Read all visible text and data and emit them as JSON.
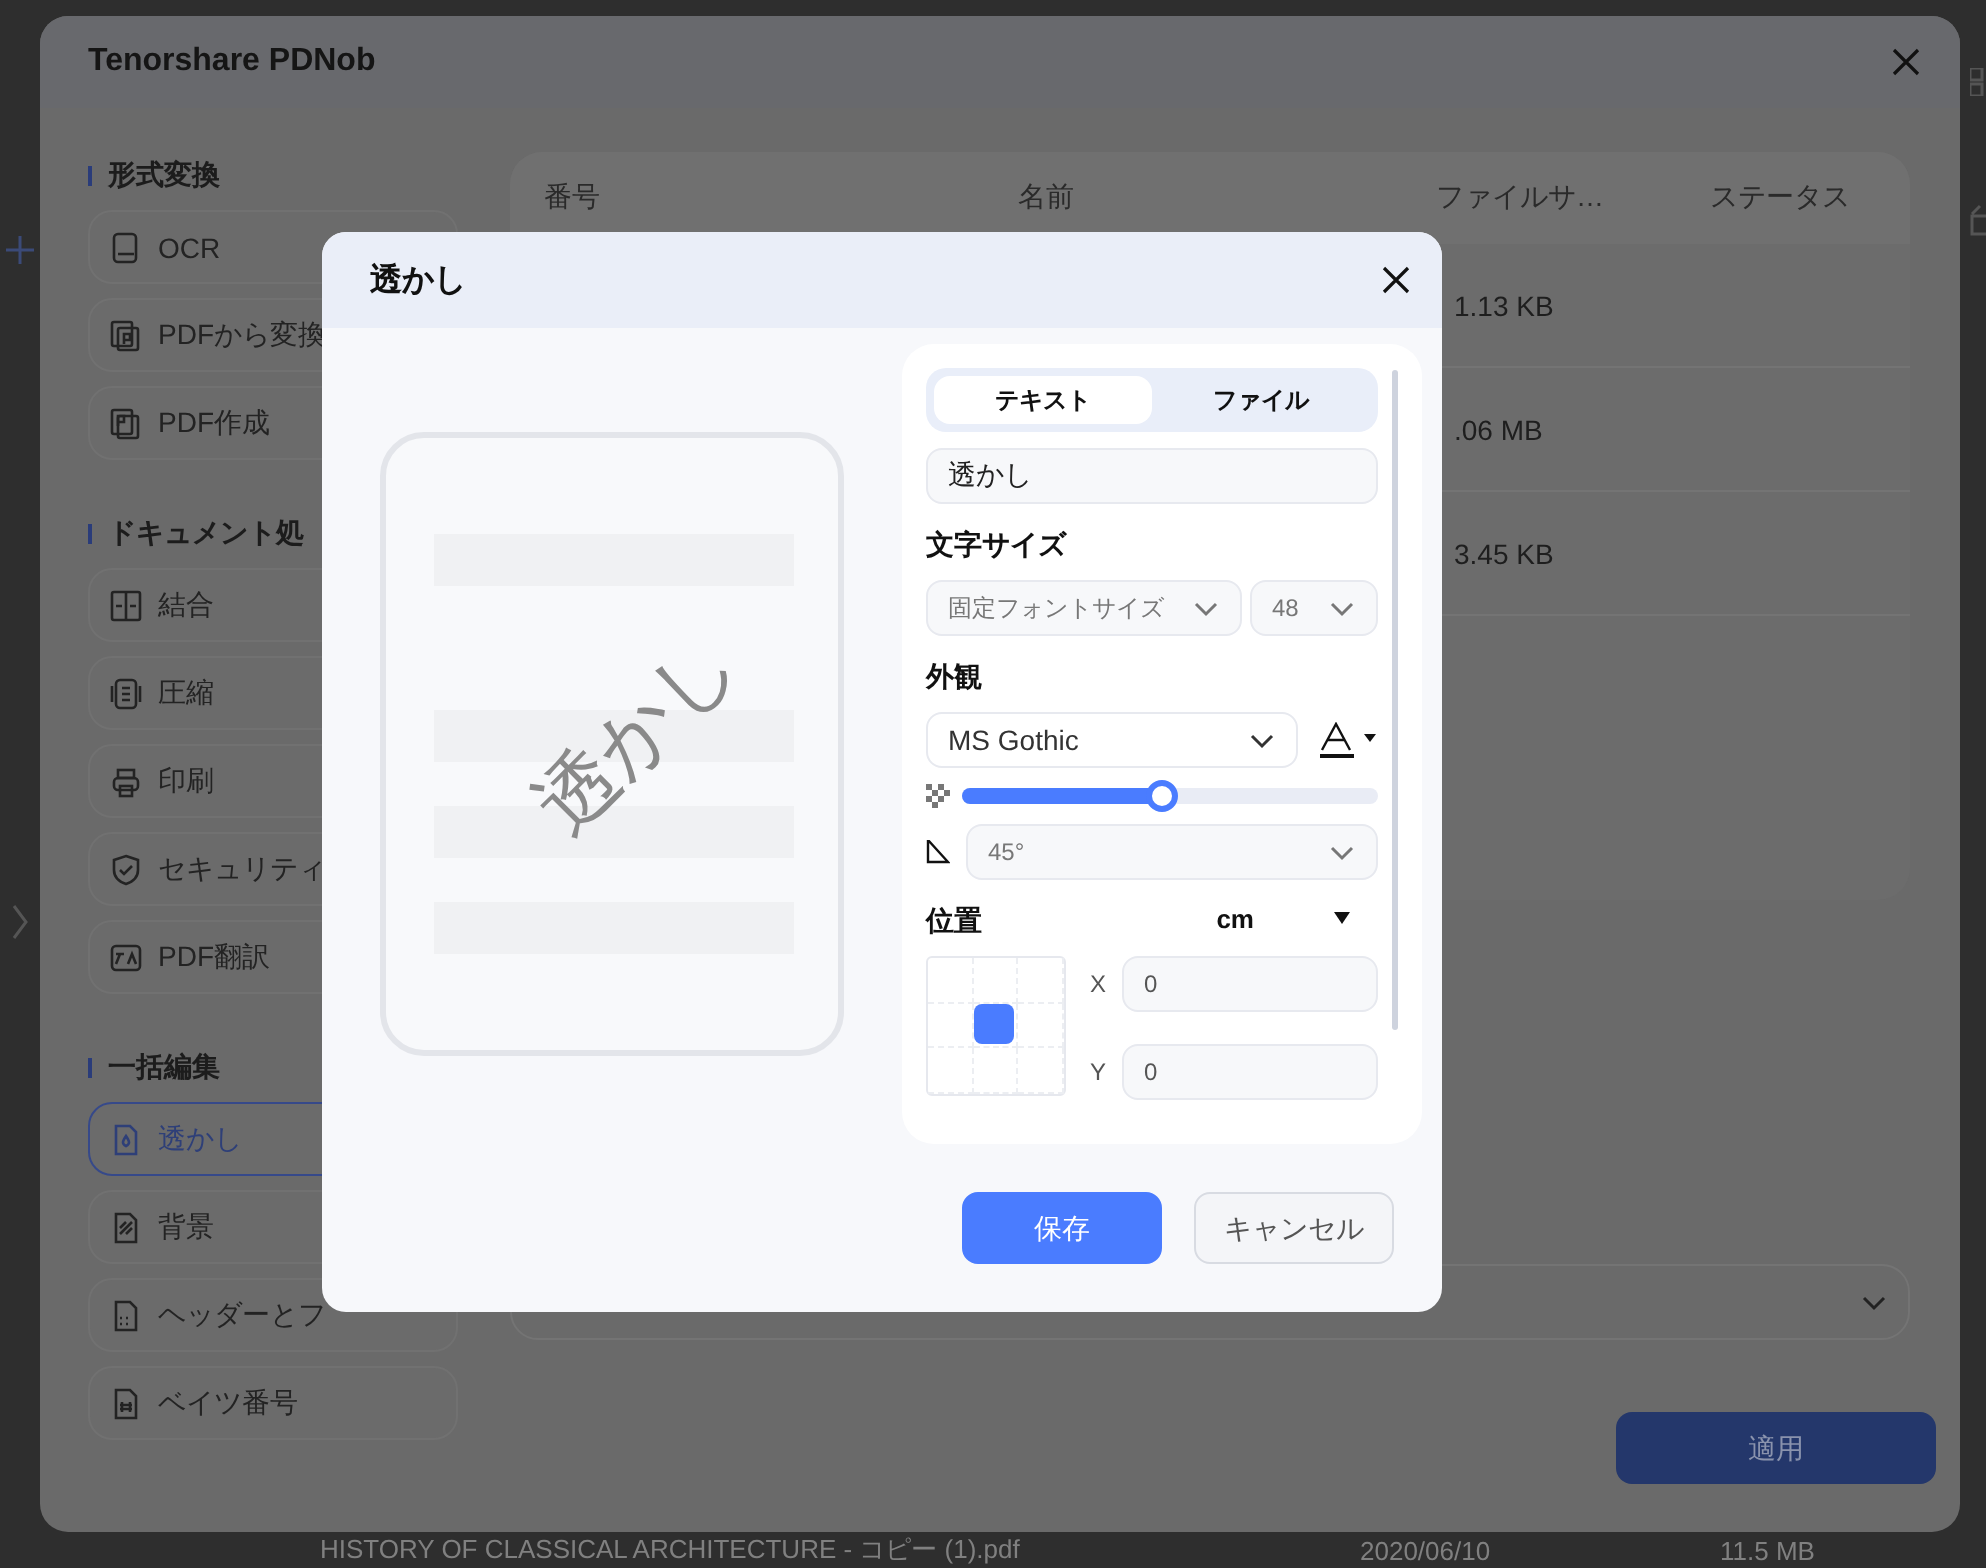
{
  "app": {
    "title": "Tenorshare PDNob"
  },
  "sidebar": {
    "sections": [
      {
        "title": "形式変換",
        "items": [
          {
            "label": "OCR",
            "selected": false
          },
          {
            "label": "PDFから変換",
            "selected": false
          },
          {
            "label": "PDF作成",
            "selected": false
          }
        ]
      },
      {
        "title": "ドキュメント処",
        "items": [
          {
            "label": "結合",
            "selected": false
          },
          {
            "label": "圧縮",
            "selected": false
          },
          {
            "label": "印刷",
            "selected": false
          },
          {
            "label": "セキュリティ",
            "selected": false
          },
          {
            "label": "PDF翻訳",
            "selected": false
          }
        ]
      },
      {
        "title": "一括編集",
        "items": [
          {
            "label": "透かし",
            "selected": true
          },
          {
            "label": "背景",
            "selected": false
          },
          {
            "label": "ヘッダーとフ",
            "selected": false
          },
          {
            "label": "ベイツ番号",
            "selected": false
          }
        ]
      }
    ]
  },
  "table": {
    "columns": [
      "番号",
      "名前",
      "ファイルサ…",
      "ステータス"
    ],
    "rows": [
      {
        "file_size": "1.13 KB"
      },
      {
        "file_size": ".06 MB"
      },
      {
        "file_size": "3.45 KB"
      }
    ]
  },
  "apply_button": "適用",
  "behind_row": {
    "name": "HISTORY OF CLASSICAL ARCHITECTURE - コピー (1).pdf",
    "date": "2020/06/10",
    "size": "11.5 MB"
  },
  "dialog": {
    "title": "透かし",
    "preview": {
      "watermark": "透かし"
    },
    "tabs": [
      {
        "label": "テキスト",
        "selected": true
      },
      {
        "label": "ファイル",
        "selected": false
      }
    ],
    "text_value": "透かし",
    "font_size_label": "文字サイズ",
    "size_mode": "固定フォントサイズ",
    "size": "48",
    "appearance_label": "外観",
    "font": "MS Gothic",
    "opacity": {
      "level": 0.48
    },
    "rotation": "45°",
    "position_label": "位置",
    "unit": "cm",
    "anchors": [
      {
        "selected": false
      },
      {
        "selected": false
      },
      {
        "selected": false
      },
      {
        "selected": false
      },
      {
        "selected": true
      },
      {
        "selected": false
      },
      {
        "selected": false
      },
      {
        "selected": false
      },
      {
        "selected": false
      }
    ],
    "x_label": "X",
    "x_value": "0",
    "y_label": "Y",
    "y_value": "0",
    "buttons": [
      {
        "label": "保存",
        "kind": "primary"
      },
      {
        "label": "キャンセル",
        "kind": "secondary"
      }
    ]
  }
}
